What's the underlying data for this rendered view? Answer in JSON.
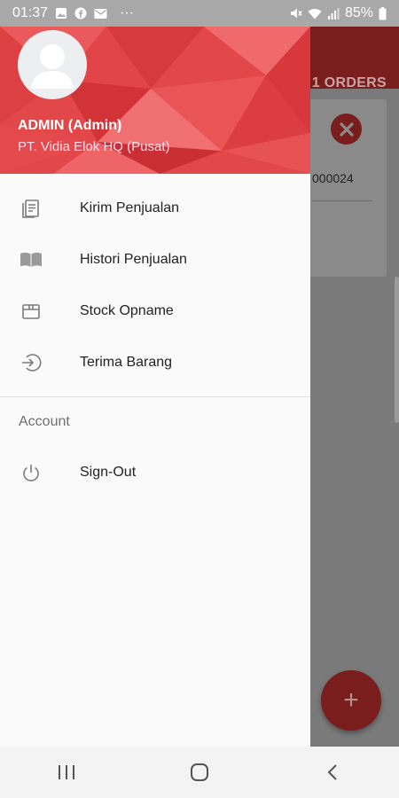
{
  "status_bar": {
    "time": "01:37",
    "battery": "85%",
    "dots": "···",
    "left_icons": [
      "image-icon",
      "facebook-icon",
      "mail-icon"
    ],
    "right_icons": [
      "mute-icon",
      "wifi-icon",
      "signal-icon",
      "battery-icon"
    ]
  },
  "background_app": {
    "orders_tab": "1 ORDERS",
    "order_code_partial": "000024",
    "fab_icon": "plus-icon",
    "accent_color": "#d32f2f"
  },
  "drawer": {
    "user_name": "ADMIN (Admin)",
    "company": "PT. Vidia Elok HQ (Pusat)",
    "header_color": "#e53935",
    "menu": [
      {
        "label": "Kirim Penjualan",
        "icon": "document-icon"
      },
      {
        "label": "Histori Penjualan",
        "icon": "book-icon"
      },
      {
        "label": "Stock Opname",
        "icon": "box-icon"
      },
      {
        "label": "Terima Barang",
        "icon": "login-arrow-icon"
      }
    ],
    "account_header": "Account",
    "account_menu": [
      {
        "label": "Sign-Out",
        "icon": "power-icon"
      }
    ]
  },
  "nav_bar": {
    "buttons": [
      "recent-apps-icon",
      "home-icon",
      "back-icon"
    ]
  }
}
